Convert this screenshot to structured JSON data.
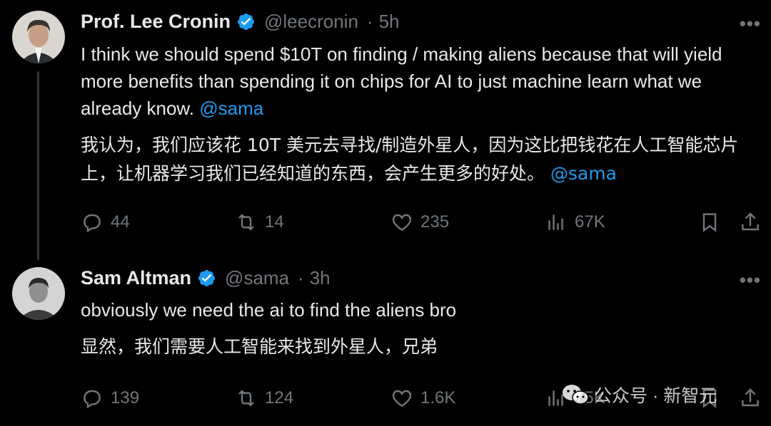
{
  "tweets": [
    {
      "author": "Prof. Lee Cronin",
      "handle": "@leecronin",
      "separator": "·",
      "time": "5h",
      "text_en": "I think we should spend $10T on finding / making aliens because that will yield more benefits than spending it on chips for AI to just machine learn what we already know.",
      "mention_en": "@sama",
      "text_cn": "我认为，我们应该花 10T 美元去寻找/制造外星人，因为这比把钱花在人工智能芯片上，让机器学习我们已经知道的东西，会产生更多的好处。",
      "mention_cn": "@sama",
      "replies": "44",
      "retweets": "14",
      "likes": "235",
      "views": "67K"
    },
    {
      "author": "Sam Altman",
      "handle": "@sama",
      "separator": "·",
      "time": "3h",
      "text_en": "obviously we need the ai to find the aliens bro",
      "text_cn": "显然，我们需要人工智能来找到外星人，兄弟",
      "replies": "139",
      "retweets": "124",
      "likes": "1.6K",
      "views": "75K"
    }
  ],
  "watermark": {
    "text": "公众号 · 新智元",
    "icon": "wechat-icon"
  },
  "colors": {
    "background": "#000000",
    "text": "#e7e9ea",
    "muted": "#71767b",
    "accent": "#1d9bf0"
  }
}
